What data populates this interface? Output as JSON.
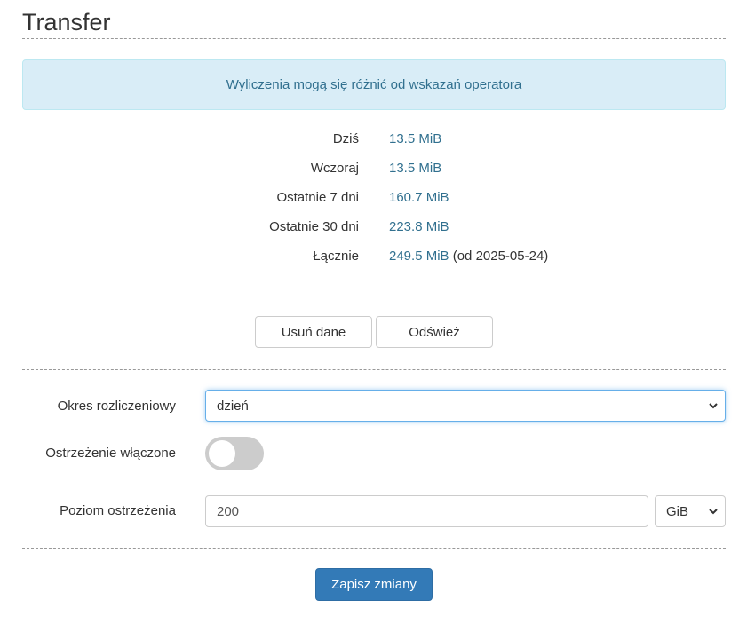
{
  "page": {
    "title": "Transfer"
  },
  "alert": {
    "text": "Wyliczenia mogą się różnić od wskazań operatora"
  },
  "stats": [
    {
      "label": "Dziś",
      "value": "13.5 MiB",
      "extra": ""
    },
    {
      "label": "Wczoraj",
      "value": "13.5 MiB",
      "extra": ""
    },
    {
      "label": "Ostatnie 7 dni",
      "value": "160.7 MiB",
      "extra": ""
    },
    {
      "label": "Ostatnie 30 dni",
      "value": "223.8 MiB",
      "extra": ""
    },
    {
      "label": "Łącznie",
      "value": "249.5 MiB",
      "extra": "(od 2025-05-24)"
    }
  ],
  "actions": {
    "delete_label": "Usuń dane",
    "refresh_label": "Odśwież"
  },
  "form": {
    "period_label": "Okres rozliczeniowy",
    "period_value": "dzień",
    "warning_enabled_label": "Ostrzeżenie włączone",
    "warning_enabled": false,
    "warning_level_label": "Poziom ostrzeżenia",
    "warning_level_value": "200",
    "unit_value": "GiB"
  },
  "save": {
    "label": "Zapisz zmiany"
  },
  "colors": {
    "primary": "#337ab7",
    "alert_bg": "#d9edf7",
    "alert_text": "#31708f"
  }
}
